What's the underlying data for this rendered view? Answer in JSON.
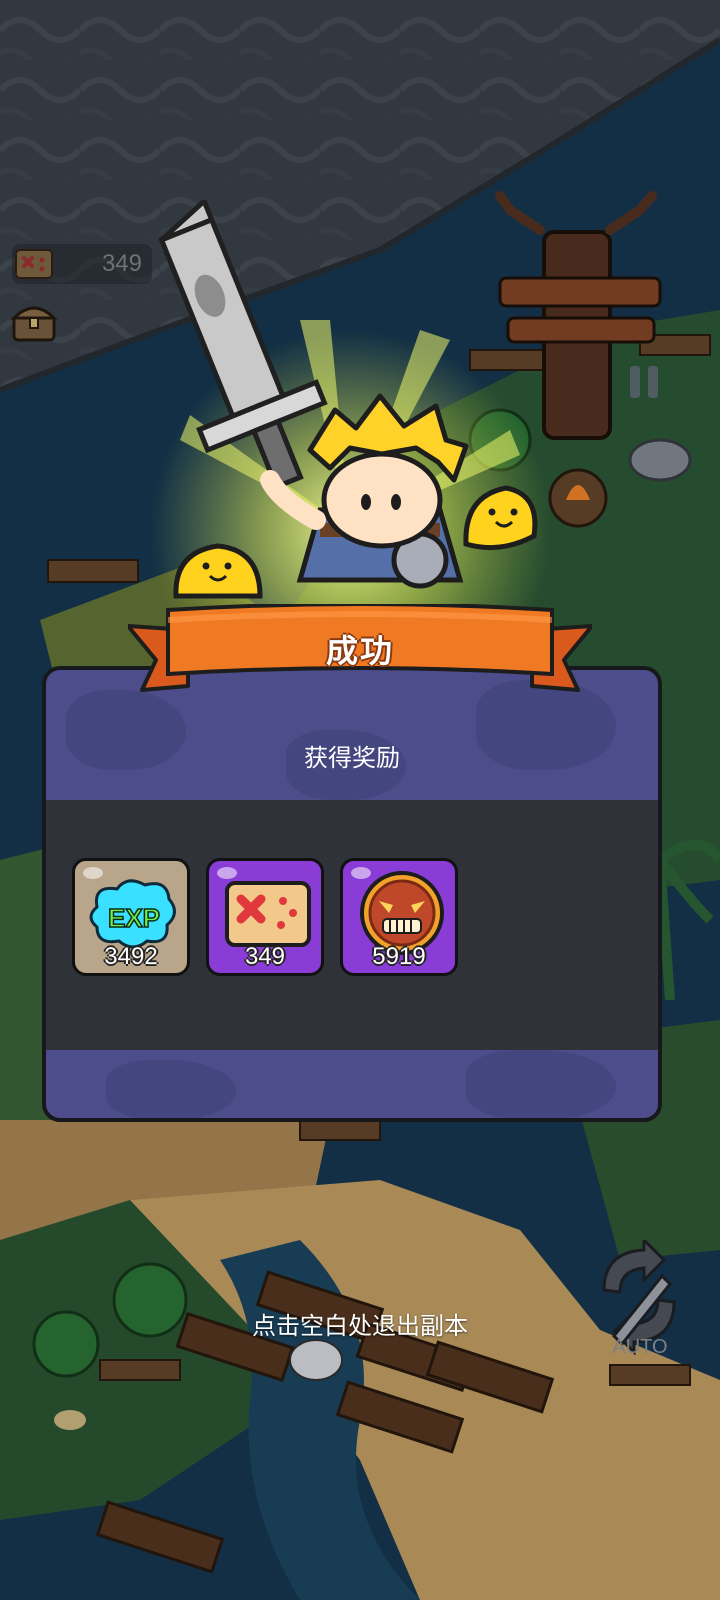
{
  "hud": {
    "map_fragments_count": "349",
    "map_icon": "treasure-map-icon",
    "chest_icon": "treasure-chest-icon",
    "pause_icon": "pause-icon"
  },
  "result": {
    "banner_title": "成功",
    "panel_title": "获得奖励",
    "rewards": [
      {
        "icon": "exp-icon",
        "count": "3492",
        "frame": "#b8a58a"
      },
      {
        "icon": "treasure-map-icon",
        "count": "349",
        "frame": "#8a3cd6"
      },
      {
        "icon": "tribal-mask-coin-icon",
        "count": "5919",
        "frame": "#8a3cd6"
      }
    ]
  },
  "footer": {
    "exit_hint": "点击空白处退出副本",
    "auto_label": "AUTO",
    "auto_icon": "auto-battle-icon"
  },
  "colors": {
    "panel": "#4c4d8a",
    "panel_mid": "#303239",
    "banner": "#f07a24",
    "water": "#173a55",
    "sand": "#d7b27a"
  }
}
